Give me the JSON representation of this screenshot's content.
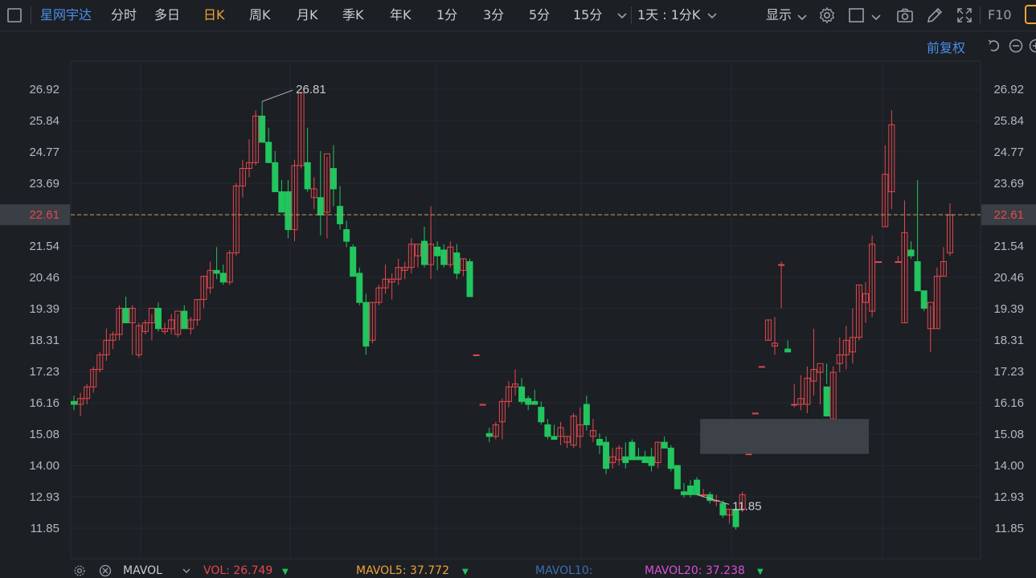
{
  "toolbar": {
    "stock_name": "星网宇达",
    "periods": [
      "分时",
      "多日",
      "日K",
      "周K",
      "月K",
      "季K",
      "年K",
      "1分",
      "3分",
      "5分",
      "15分"
    ],
    "active_period": "日K",
    "interval_select": "1天 : 1分K",
    "display_label": "显示",
    "f10_label": "F10"
  },
  "adjust_label": "前复权",
  "colors": {
    "background": "#1c1f24",
    "up": "#e5484d",
    "down": "#22c55e",
    "accent": "#f0a23a",
    "link": "#4a8fe8",
    "current_price_line": "#c9a15a"
  },
  "chart_data": {
    "type": "candlestick",
    "y_axis_ticks": [
      "26.92",
      "25.84",
      "24.77",
      "23.69",
      "22.61",
      "21.54",
      "20.46",
      "19.39",
      "18.31",
      "17.23",
      "16.16",
      "15.08",
      "14.00",
      "12.93",
      "11.85"
    ],
    "ylim": [
      11.85,
      26.92
    ],
    "current_price": "22.61",
    "annotations": [
      {
        "label": "26.81",
        "kind": "high",
        "candle_index": 29
      },
      {
        "label": "11.85",
        "kind": "low",
        "candle_index": 96
      }
    ],
    "candles": [
      [
        16.2,
        16.4,
        15.9,
        16.1
      ],
      [
        16.1,
        16.5,
        15.7,
        16.3
      ],
      [
        16.3,
        16.8,
        16.1,
        16.7
      ],
      [
        16.7,
        17.4,
        16.5,
        17.3
      ],
      [
        17.3,
        17.9,
        17.2,
        17.8
      ],
      [
        17.8,
        18.7,
        17.6,
        18.3
      ],
      [
        18.3,
        18.6,
        18.0,
        18.5
      ],
      [
        18.5,
        19.5,
        18.3,
        19.4
      ],
      [
        19.4,
        19.8,
        18.9,
        18.9
      ],
      [
        18.9,
        19.5,
        17.8,
        19.4
      ],
      [
        17.8,
        18.9,
        17.7,
        18.8
      ],
      [
        18.6,
        19.0,
        18.5,
        18.9
      ],
      [
        18.9,
        19.2,
        18.3,
        19.4
      ],
      [
        19.4,
        19.6,
        18.6,
        18.7
      ],
      [
        18.6,
        18.9,
        18.5,
        18.7
      ],
      [
        18.7,
        19.2,
        18.5,
        19.0
      ],
      [
        18.5,
        19.2,
        18.4,
        19.3
      ],
      [
        19.3,
        19.5,
        18.8,
        18.7
      ],
      [
        18.7,
        19.1,
        18.5,
        19.0
      ],
      [
        19.0,
        19.7,
        18.8,
        19.7
      ],
      [
        19.7,
        20.5,
        19.4,
        20.5
      ],
      [
        20.1,
        21.0,
        19.9,
        20.7
      ],
      [
        20.7,
        21.5,
        20.4,
        20.6
      ],
      [
        20.6,
        20.9,
        20.2,
        20.3
      ],
      [
        20.3,
        21.4,
        20.2,
        21.3
      ],
      [
        21.3,
        23.7,
        21.2,
        23.6
      ],
      [
        23.6,
        24.5,
        23.2,
        24.2
      ],
      [
        24.2,
        25.2,
        23.9,
        24.4
      ],
      [
        24.4,
        26.2,
        24.3,
        26.0
      ],
      [
        26.0,
        26.5,
        25.7,
        25.1
      ],
      [
        25.1,
        25.6,
        24.4,
        24.4
      ],
      [
        24.4,
        24.8,
        23.6,
        23.4
      ],
      [
        23.4,
        23.8,
        22.7,
        22.7
      ],
      [
        23.4,
        23.8,
        21.8,
        22.1
      ],
      [
        22.1,
        24.5,
        21.7,
        24.3
      ],
      [
        24.3,
        26.8,
        24.2,
        26.8
      ],
      [
        24.4,
        25.6,
        23.4,
        23.5
      ],
      [
        23.2,
        23.9,
        22.8,
        23.5
      ],
      [
        23.2,
        24.8,
        21.9,
        22.6
      ],
      [
        22.7,
        24.6,
        21.8,
        24.7
      ],
      [
        24.2,
        25.0,
        22.9,
        23.5
      ],
      [
        22.9,
        23.6,
        22.1,
        22.3
      ],
      [
        22.1,
        22.4,
        21.5,
        21.7
      ],
      [
        21.5,
        21.6,
        20.5,
        20.5
      ],
      [
        20.6,
        20.8,
        19.5,
        19.6
      ],
      [
        19.6,
        19.9,
        17.8,
        18.1
      ],
      [
        18.3,
        19.6,
        18.2,
        19.6
      ],
      [
        19.6,
        20.2,
        19.5,
        20.1
      ],
      [
        20.1,
        20.9,
        19.9,
        20.4
      ],
      [
        20.3,
        20.6,
        19.7,
        20.4
      ],
      [
        20.4,
        21.1,
        20.2,
        20.8
      ],
      [
        20.7,
        21.0,
        20.4,
        20.8
      ],
      [
        20.8,
        21.8,
        20.6,
        21.6
      ],
      [
        21.2,
        21.6,
        20.8,
        21.6
      ],
      [
        21.7,
        22.2,
        20.8,
        20.9
      ],
      [
        20.9,
        22.9,
        20.4,
        21.6
      ],
      [
        21.5,
        21.7,
        20.7,
        21.2
      ],
      [
        21.4,
        21.6,
        20.8,
        20.9
      ],
      [
        20.9,
        21.7,
        20.8,
        21.5
      ],
      [
        21.3,
        21.6,
        20.4,
        20.6
      ],
      [
        20.7,
        21.1,
        20.5,
        21.1
      ],
      [
        21.0,
        21.1,
        19.8,
        19.8
      ],
      [
        17.8,
        17.8,
        17.8,
        17.8
      ],
      [
        16.1,
        16.1,
        16.1,
        16.1
      ],
      [
        15.1,
        15.3,
        14.8,
        15.0
      ],
      [
        15.0,
        15.5,
        14.9,
        15.4
      ],
      [
        15.5,
        16.3,
        14.9,
        16.2
      ],
      [
        16.2,
        16.9,
        16.0,
        16.7
      ],
      [
        16.7,
        17.3,
        16.4,
        16.8
      ],
      [
        16.7,
        17.0,
        16.1,
        16.2
      ],
      [
        16.3,
        16.4,
        15.9,
        16.1
      ],
      [
        16.2,
        16.6,
        16.1,
        16.1
      ],
      [
        16.0,
        16.2,
        15.4,
        15.5
      ],
      [
        15.4,
        15.6,
        14.9,
        15.0
      ],
      [
        15.0,
        15.4,
        14.9,
        14.9
      ],
      [
        15.0,
        15.5,
        14.7,
        15.3
      ],
      [
        14.8,
        15.0,
        14.6,
        15.0
      ],
      [
        14.7,
        15.8,
        14.6,
        15.7
      ],
      [
        15.0,
        16.0,
        14.6,
        15.4
      ],
      [
        16.1,
        16.4,
        15.2,
        15.4
      ],
      [
        15.0,
        15.6,
        14.8,
        15.2
      ],
      [
        14.9,
        15.1,
        14.4,
        14.7
      ],
      [
        14.8,
        15.0,
        13.7,
        13.9
      ],
      [
        14.1,
        14.6,
        13.9,
        14.3
      ],
      [
        14.2,
        14.7,
        14.0,
        14.6
      ],
      [
        14.3,
        14.8,
        13.9,
        14.1
      ],
      [
        14.8,
        14.9,
        14.2,
        14.2
      ],
      [
        14.3,
        14.6,
        14.2,
        14.2
      ],
      [
        14.3,
        14.5,
        14.1,
        14.1
      ],
      [
        14.3,
        14.6,
        13.8,
        14.0
      ],
      [
        14.1,
        14.8,
        13.9,
        14.8
      ],
      [
        14.8,
        15.0,
        14.6,
        14.6
      ],
      [
        14.6,
        14.7,
        13.8,
        13.9
      ],
      [
        14.0,
        14.0,
        13.2,
        13.2
      ],
      [
        13.1,
        13.4,
        12.9,
        13.0
      ],
      [
        13.3,
        13.5,
        12.9,
        13.0
      ],
      [
        13.5,
        13.6,
        13.0,
        13.0
      ],
      [
        13.0,
        13.2,
        12.9,
        13.0
      ],
      [
        13.0,
        13.1,
        12.7,
        12.8
      ],
      [
        12.8,
        13.0,
        12.6,
        12.8
      ],
      [
        12.7,
        12.8,
        12.2,
        12.3
      ],
      [
        12.3,
        12.5,
        12.0,
        12.5
      ],
      [
        12.5,
        12.6,
        11.8,
        11.9
      ],
      [
        12.5,
        13.1,
        12.4,
        13.0
      ],
      [
        14.4,
        14.4,
        14.4,
        14.4
      ],
      [
        15.8,
        15.8,
        15.8,
        15.8
      ],
      [
        17.4,
        17.4,
        17.4,
        17.4
      ],
      [
        18.3,
        19.0,
        18.3,
        19.0
      ],
      [
        18.1,
        19.1,
        17.8,
        18.2
      ],
      [
        20.9,
        21.0,
        19.4,
        20.9
      ],
      [
        18.0,
        18.3,
        17.9,
        17.9
      ],
      [
        16.1,
        16.8,
        16.0,
        16.1
      ],
      [
        16.1,
        17.1,
        15.9,
        16.3
      ],
      [
        16.1,
        17.4,
        15.8,
        17.0
      ],
      [
        16.9,
        18.7,
        16.4,
        17.3
      ],
      [
        17.2,
        17.4,
        16.1,
        17.5
      ],
      [
        16.7,
        17.5,
        16.8,
        15.7
      ],
      [
        15.6,
        17.4,
        15.5,
        17.2
      ],
      [
        17.5,
        18.4,
        17.2,
        17.8
      ],
      [
        17.8,
        18.8,
        17.3,
        18.3
      ],
      [
        17.9,
        19.4,
        17.5,
        18.4
      ],
      [
        18.4,
        20.2,
        18.3,
        20.2
      ],
      [
        19.6,
        20.3,
        18.9,
        19.9
      ],
      [
        19.3,
        21.9,
        19.1,
        21.6
      ],
      [
        21.0,
        21.0,
        21.0,
        21.0
      ],
      [
        22.2,
        25.0,
        22.2,
        24.0
      ],
      [
        23.4,
        26.2,
        22.8,
        25.7
      ],
      [
        21.0,
        21.2,
        21.0,
        21.0
      ],
      [
        18.9,
        23.1,
        18.9,
        22.0
      ],
      [
        21.4,
        21.7,
        21.1,
        21.2
      ],
      [
        21.0,
        23.8,
        20.0,
        20.0
      ],
      [
        20.0,
        19.6,
        19.3,
        19.4
      ],
      [
        18.7,
        19.5,
        17.9,
        19.6
      ],
      [
        18.7,
        20.8,
        18.7,
        20.5
      ],
      [
        20.5,
        21.5,
        20.5,
        21.0
      ],
      [
        21.3,
        23.0,
        21.2,
        22.6
      ]
    ],
    "placeholder_box": {
      "x_start_index": 97,
      "x_end_index": 122,
      "y_top": 15.6,
      "y_bottom": 14.4
    }
  },
  "indicator": {
    "name": "MAVOL",
    "vol": "VOL: 26.749",
    "ma5": "MAVOL5: 37.772",
    "ma10": "MAVOL10:",
    "ma20": "MAVOL20: 37.238"
  }
}
